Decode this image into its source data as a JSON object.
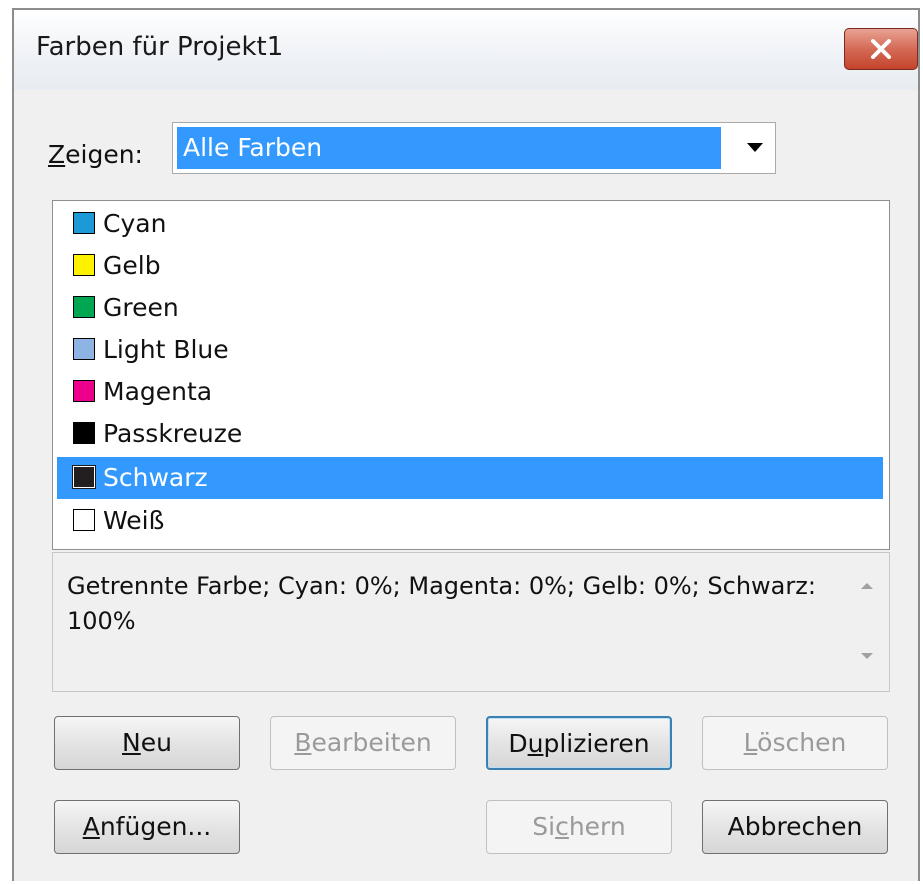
{
  "window": {
    "title": "Farben für Projekt1",
    "close_icon": "close-x-icon"
  },
  "show": {
    "label_hotkey": "Z",
    "label_rest": "eigen:",
    "selected": "Alle Farben"
  },
  "colors": {
    "items": [
      {
        "label": "Cyan",
        "color": "#1c9ad6",
        "selected": false
      },
      {
        "label": "Gelb",
        "color": "#fff200",
        "selected": false
      },
      {
        "label": "Green",
        "color": "#00a651",
        "selected": false
      },
      {
        "label": "Light Blue",
        "color": "#8db4e2",
        "selected": false
      },
      {
        "label": "Magenta",
        "color": "#ec008c",
        "selected": false
      },
      {
        "label": "Passkreuze",
        "color": "#000000",
        "selected": false
      },
      {
        "label": "Schwarz",
        "color": "#231f20",
        "selected": true
      },
      {
        "label": "Weiß",
        "color": "#ffffff",
        "selected": false
      }
    ]
  },
  "info": {
    "text": "Getrennte Farbe; Cyan: 0%; Magenta: 0%; Gelb: 0%; Schwarz: 100%"
  },
  "buttons": {
    "new": {
      "hotkey": "N",
      "rest": "eu",
      "pre": ""
    },
    "edit": {
      "hotkey": "B",
      "rest": "earbeiten",
      "pre": "",
      "disabled": true
    },
    "duplicate": {
      "pre": "D",
      "hotkey": "u",
      "rest": "plizieren"
    },
    "delete": {
      "pre": "",
      "hotkey": "L",
      "rest": "öschen",
      "disabled": true
    },
    "append": {
      "pre": "",
      "hotkey": "A",
      "rest": "nfügen..."
    },
    "save": {
      "pre": "Si",
      "hotkey": "c",
      "rest": "hern",
      "disabled": true
    },
    "cancel": {
      "label": "Abbrechen"
    }
  }
}
